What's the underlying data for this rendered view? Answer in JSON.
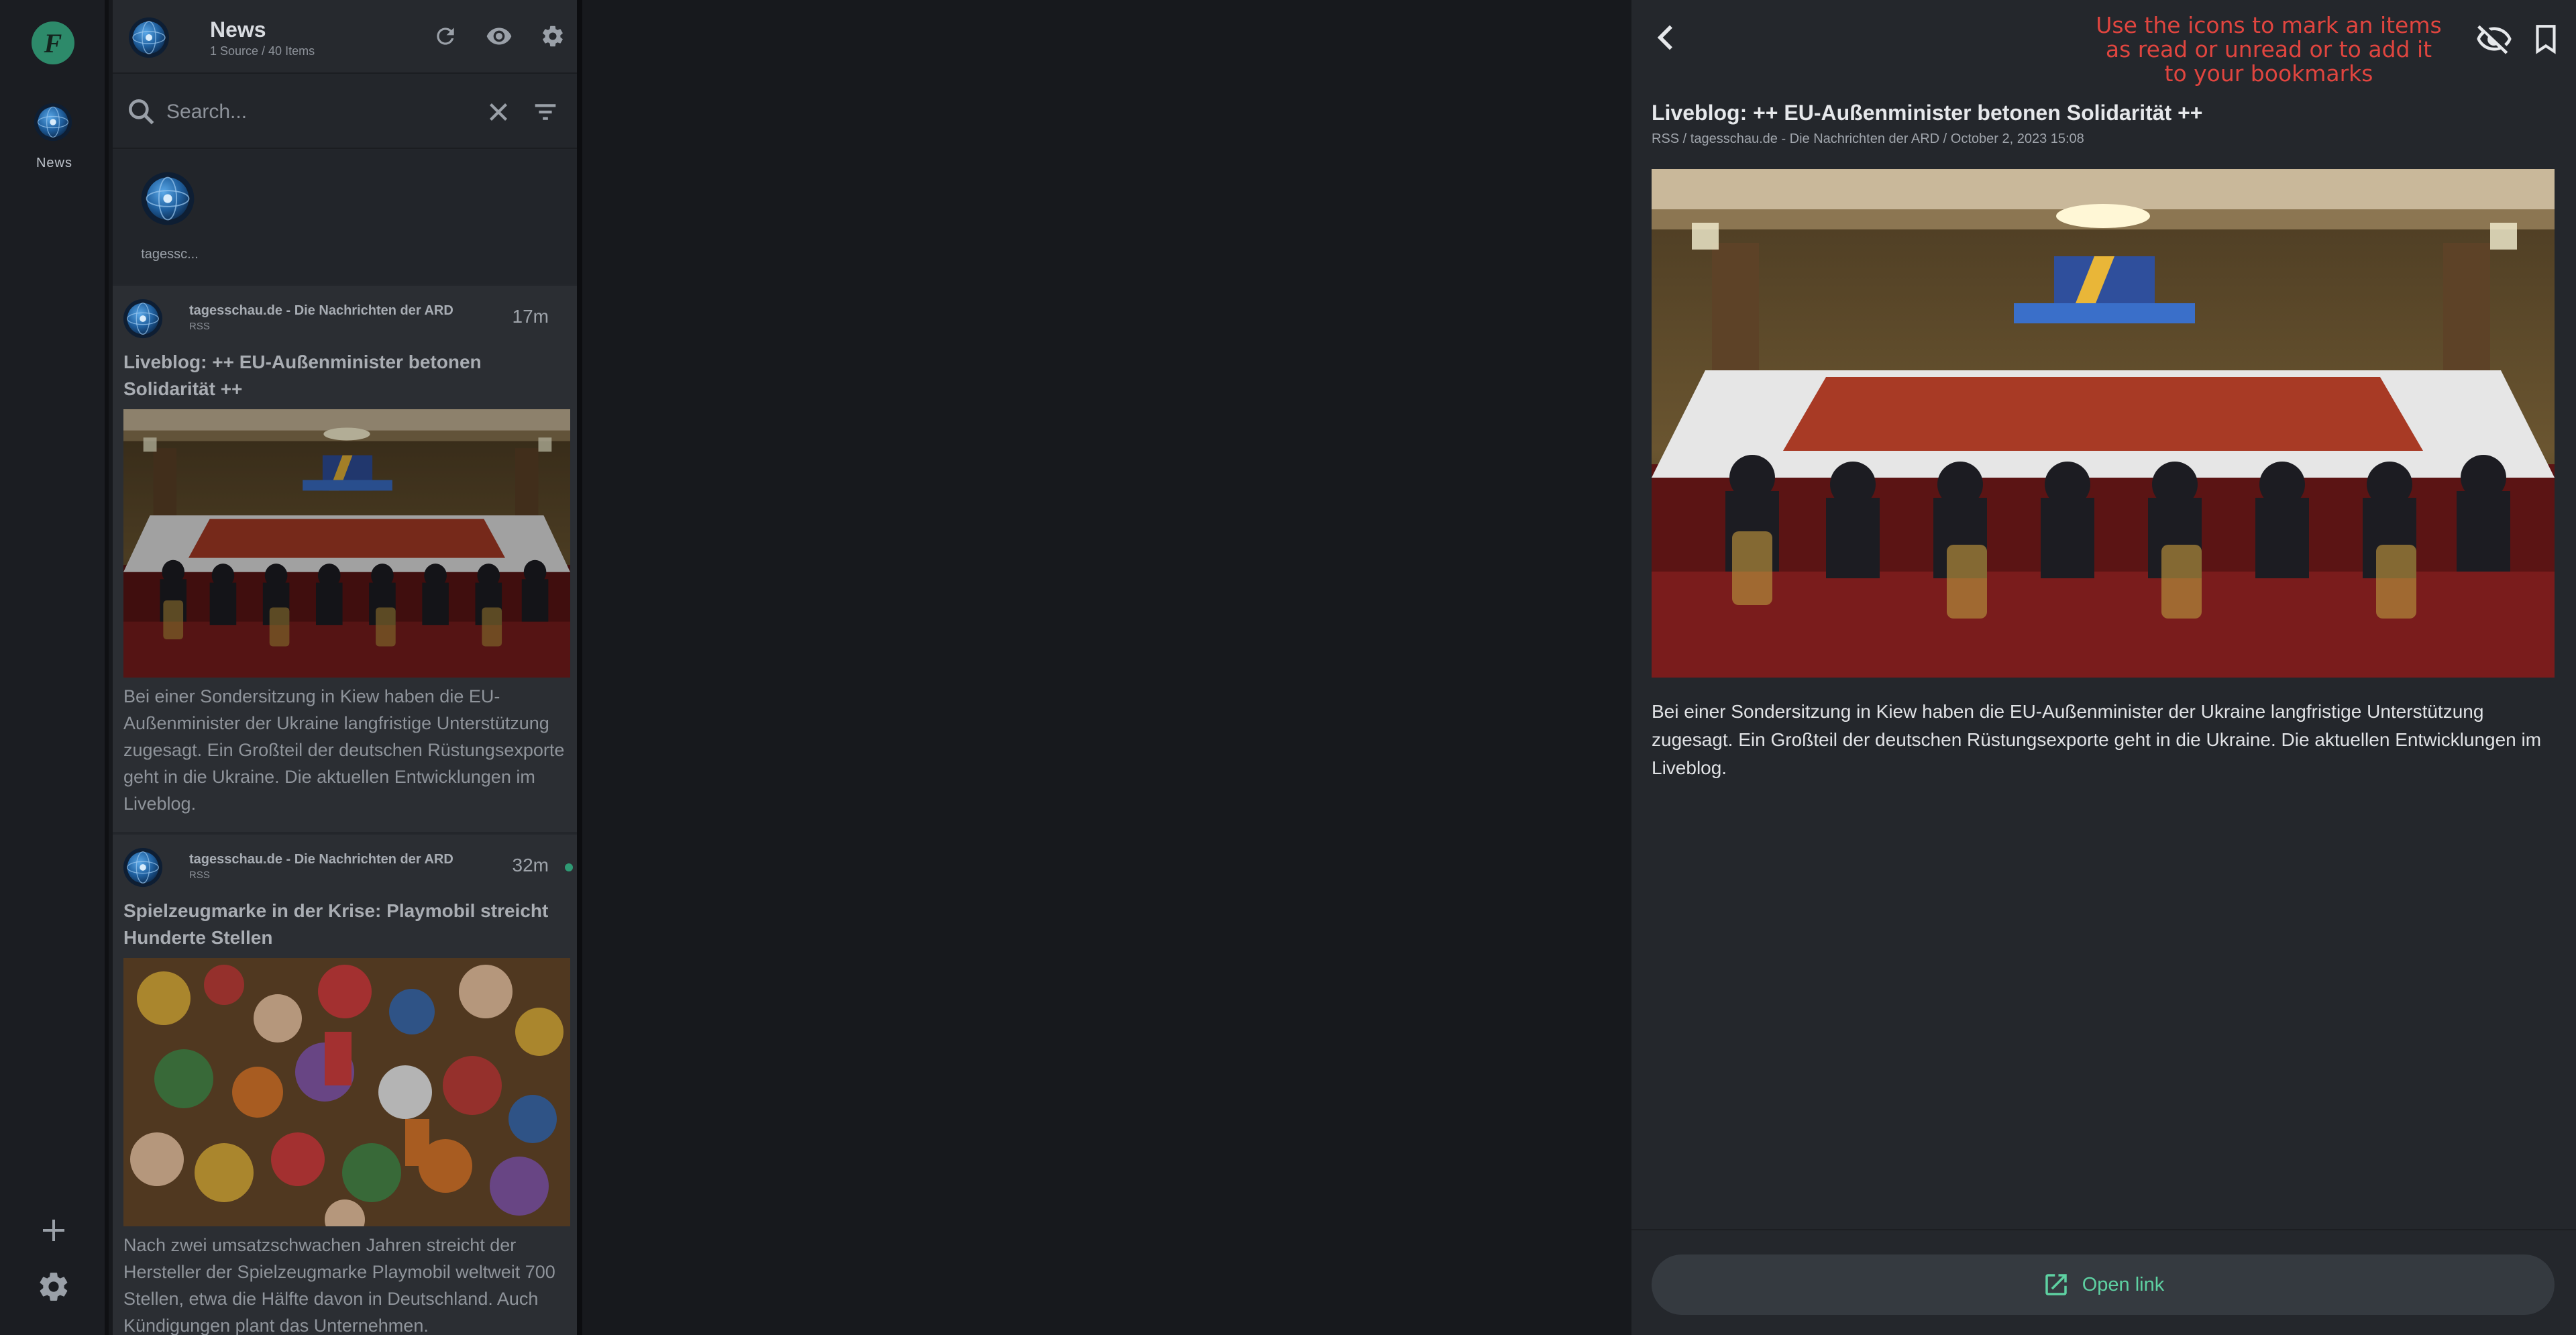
{
  "app": {
    "logo_letter": "F"
  },
  "rail": {
    "feed_label": "News",
    "icons": {
      "add": "plus-icon",
      "settings": "gear-icon"
    }
  },
  "list": {
    "title": "News",
    "subtitle": "1 Source / 40 Items",
    "actions": [
      "refresh-icon",
      "eye-icon",
      "gear-icon"
    ],
    "search": {
      "placeholder": "Search...",
      "value": ""
    },
    "sources": [
      {
        "label": "tagessc..."
      }
    ],
    "items": [
      {
        "source": "tagesschau.de - Die Nachrichten der ARD",
        "type": "RSS",
        "age": "17m",
        "unread": false,
        "headline": "Liveblog: ++  EU-Außenminister betonen Solidarität ++",
        "description": "Bei einer Sondersitzung in Kiew haben die EU-Außenminister der Ukraine langfristige Unterstützung zugesagt. Ein Großteil der deutschen Rüstungsexporte geht in die Ukraine. Die aktuellen Entwicklungen im Liveblog."
      },
      {
        "source": "tagesschau.de - Die Nachrichten der ARD",
        "type": "RSS",
        "age": "32m",
        "unread": true,
        "headline": "Spielzeugmarke in der Krise: Playmobil streicht Hunderte Stellen",
        "description": "Nach zwei umsatzschwachen Jahren streicht der Hersteller der Spielzeugmarke Playmobil weltweit 700 Stellen, etwa die Hälfte davon in Deutschland. Auch Kündigungen plant das Unternehmen."
      }
    ]
  },
  "detail": {
    "hint": "Use the icons to mark an items as read or unread or to add it to your bookmarks",
    "title": "Liveblog: ++  EU-Außenminister betonen Solidarität ++",
    "meta": "RSS / tagesschau.de - Die Nachrichten der ARD / October 2, 2023 15:08",
    "body": "Bei einer Sondersitzung in Kiew haben die EU-Außenminister der Ukraine langfristige Unterstützung zugesagt. Ein Großteil der deutschen Rüstungsexporte geht in die Ukraine. Die aktuellen Entwicklungen im Liveblog.",
    "open_link_label": "Open link"
  },
  "colors": {
    "accent": "#5ed1a2",
    "annotation": "#e0453f",
    "unread_dot": "#2f9a74"
  }
}
